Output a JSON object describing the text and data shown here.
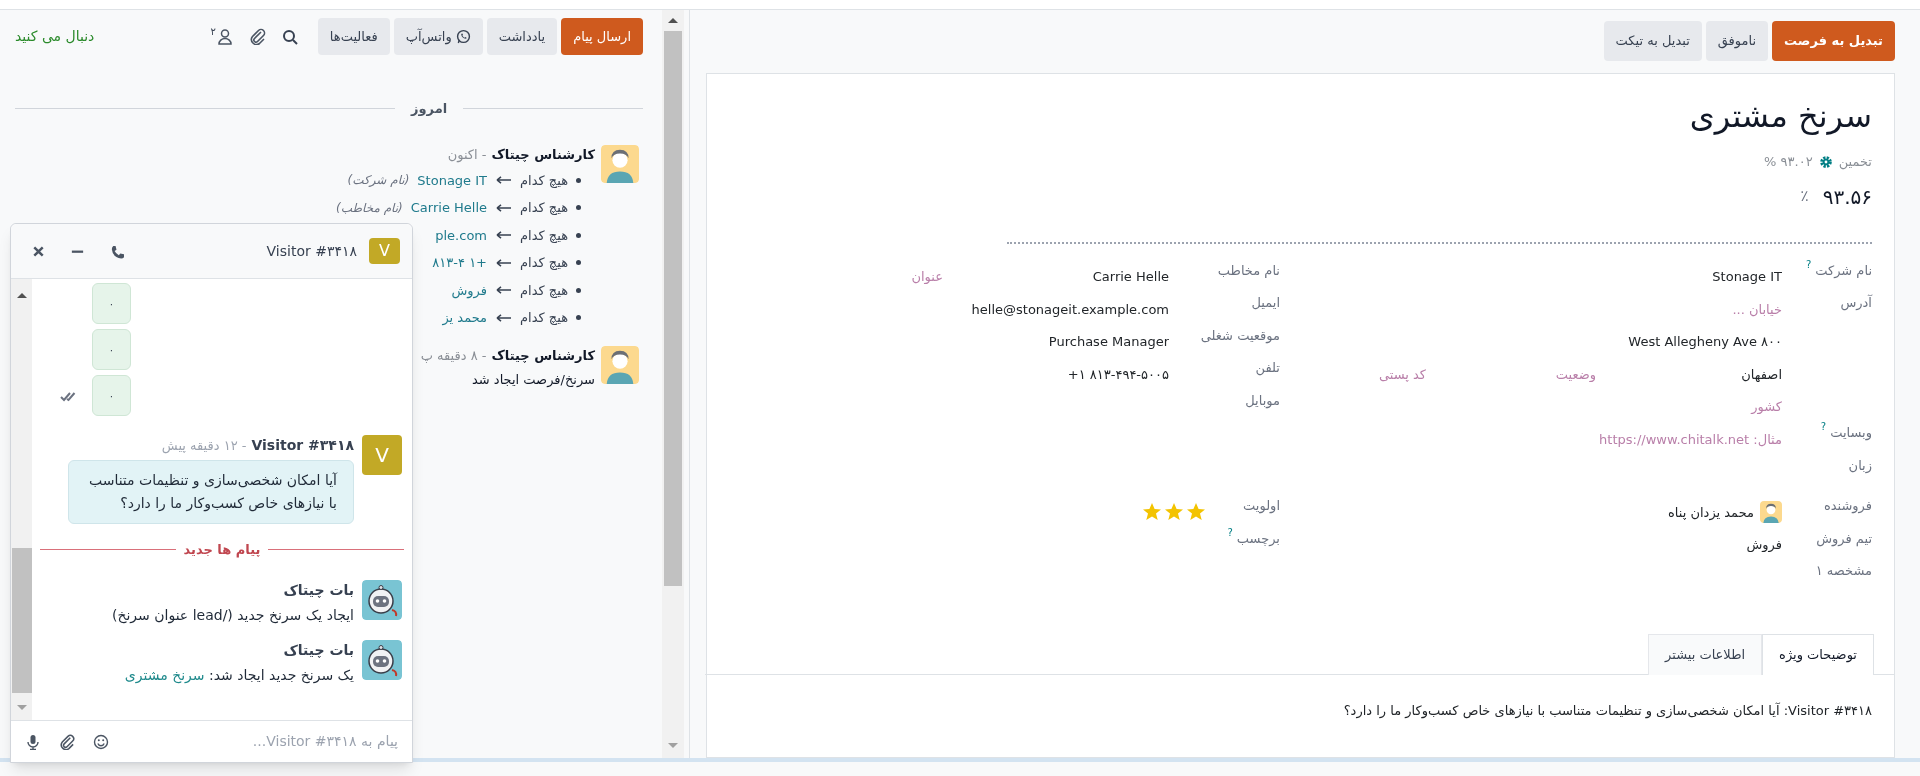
{
  "form": {
    "buttons": [
      {
        "label": "تبدیل به فرصت",
        "kind": "primary"
      },
      {
        "label": "ناموفق",
        "kind": "secondary"
      },
      {
        "label": "تبدیل به تیکت",
        "kind": "secondary"
      }
    ],
    "title": "سرنخ مشتری",
    "estimate": {
      "label": "تخمین",
      "value": "۹۳.۰۲ %"
    },
    "probability": {
      "value": "۹۳.۵۶",
      "unit": "٪"
    },
    "right_fields": [
      {
        "label": "نام شرکت",
        "help": "?",
        "kind": "text",
        "value": "Stonage IT"
      },
      {
        "label": "آدرس",
        "kind": "address",
        "street": {
          "placeholder": "خیابان ..."
        },
        "street2": {
          "value": "West Allegheny Ave ۸۰۰"
        },
        "city": {
          "value": "اصفهان"
        },
        "state": {
          "placeholder": "وضعیت"
        },
        "zip": {
          "placeholder": "کد پستی"
        },
        "country": {
          "placeholder": "کشور"
        }
      },
      {
        "label": "وبسایت",
        "help": "?",
        "kind": "text",
        "placeholder": "مثال: https://www.chitalk.net"
      },
      {
        "label": "زبان",
        "kind": "text"
      }
    ],
    "left_fields": [
      {
        "label": "نام مخاطب",
        "kind": "contact",
        "value": "Carrie Helle",
        "title": {
          "placeholder": "عنوان"
        }
      },
      {
        "label": "ایمیل",
        "kind": "text",
        "value": "helle@stonageit.example.com"
      },
      {
        "label": "موقعیت شغلی",
        "kind": "text",
        "value": "Purchase Manager"
      },
      {
        "label": "تلفن",
        "kind": "phone",
        "value": "+۱ ۸۱۳-۴۹۴-۵۰۰۵"
      },
      {
        "label": "موبایل",
        "kind": "text"
      }
    ],
    "right_fields_2": [
      {
        "label": "فروشنده",
        "kind": "user",
        "value": "محمد یزدان پناه"
      },
      {
        "label": "تیم فروش",
        "kind": "text",
        "value": "فروش"
      },
      {
        "label": "مشخصه ۱",
        "kind": "text"
      }
    ],
    "left_fields_2": [
      {
        "label": "اولویت",
        "kind": "priority",
        "stars": 3
      },
      {
        "label": "برچسب",
        "help": "?",
        "kind": "text"
      }
    ],
    "tabs": [
      {
        "label": "توضیحات ویژه",
        "selected": true
      },
      {
        "label": "اطلاعات بیشتر",
        "selected": false
      }
    ],
    "description": "Visitor #۳۴۱۸: آیا امکان شخصی‌سازی و تنظیمات متناسب با نیازهای خاص کسب‌وکار ما را دارد؟"
  },
  "chatter": {
    "buttons": [
      {
        "label": "ارسال پیام",
        "selected": true,
        "kind": "text"
      },
      {
        "label": "یادداشت",
        "selected": false,
        "kind": "text"
      },
      {
        "label": "واتس‌آپ",
        "selected": false,
        "kind": "whatsapp"
      },
      {
        "label": "فعالیت‌ها",
        "selected": false,
        "kind": "text"
      }
    ],
    "follower_count": "۲",
    "follow_link": "دنبال می کنید",
    "date_divider": "امروز",
    "messages": [
      {
        "author": "کارشناس چیتاک",
        "time": "- اکنون",
        "changes": [
          {
            "old": "هیچ کدام",
            "new": "Stonage IT",
            "field": "(نام شرکت)"
          },
          {
            "old": "هیچ کدام",
            "new": "Carrie Helle",
            "field": "(نام مخاطب)"
          },
          {
            "old": "هیچ کدام",
            "new": "ple.com"
          },
          {
            "old": "هیچ کدام",
            "new": "+۱ ۸۱۳-۴"
          },
          {
            "old": "هیچ کدام",
            "new": "فروش"
          },
          {
            "old": "هیچ کدام",
            "new": "محمد یز"
          }
        ]
      },
      {
        "author": "کارشناس چیتاک",
        "time": "- ۸ دقیقه پ",
        "body": "سرنخ/فرصت ایجاد شد"
      }
    ]
  },
  "chat_window": {
    "avatar": "V",
    "title": "Visitor #۳۴۱۸",
    "messages": [
      {
        "kind": "sent",
        "text": "۰",
        "seen": false
      },
      {
        "kind": "sent",
        "text": "۰",
        "seen": false
      },
      {
        "kind": "sent",
        "text": "۰",
        "seen": true
      },
      {
        "kind": "visitor",
        "avatar": "V",
        "author": "Visitor #۳۴۱۸",
        "time": "- ۱۲ دقیقه پیش",
        "text": "آیا امکان شخصی‌سازی و تنظیمات متناسب با نیازهای خاص کسب‌وکار ما را دارد؟"
      },
      {
        "kind": "separator",
        "text": "پیام ها جدید"
      },
      {
        "kind": "bot",
        "author": "بات چیتاک",
        "text": "ایجاد یک سرنخ جدید (/lead عنوان سرنخ)"
      },
      {
        "kind": "bot",
        "author": "بات چیتاک",
        "text": "یک سرنخ جدید ایجاد شد: ",
        "link": "سرنخ مشتری"
      }
    ],
    "composer_placeholder": "پیام به Visitor #۳۴۱۸..."
  }
}
